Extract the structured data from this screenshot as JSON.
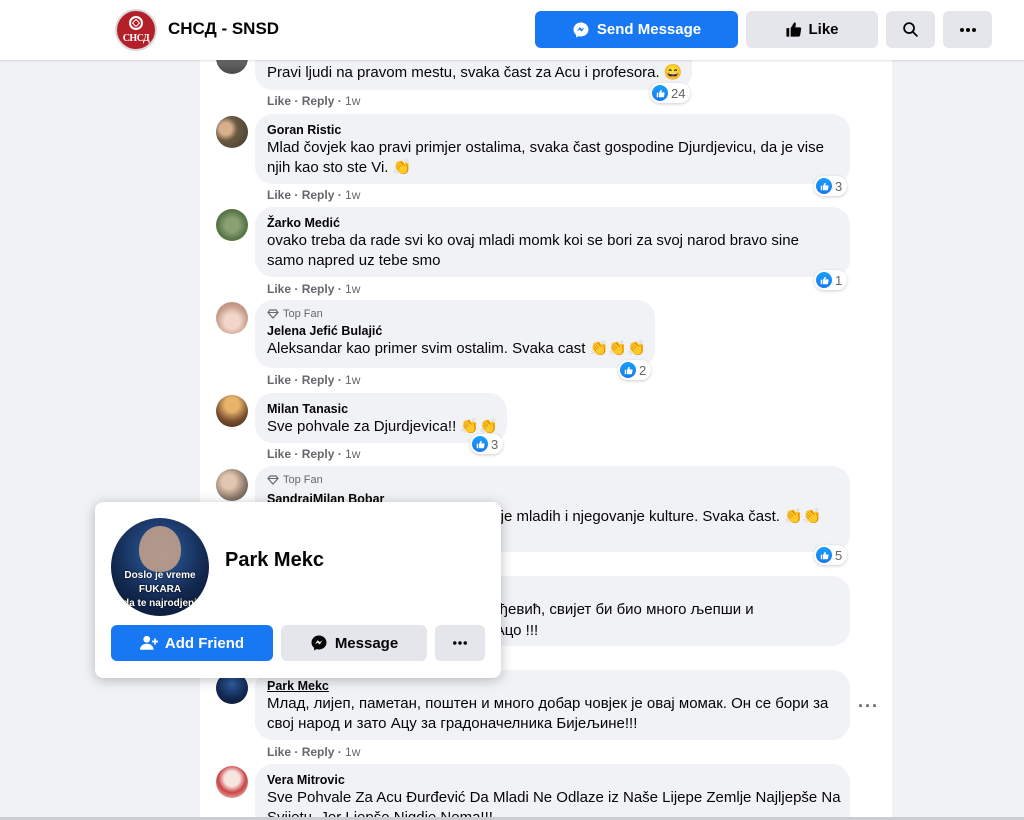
{
  "header": {
    "logo_text": "СНСД",
    "page_name": "СНСД - SNSD",
    "send_message_label": "Send Message",
    "like_label": "Like"
  },
  "comment_actions": {
    "like": "Like",
    "reply": "Reply"
  },
  "comments": [
    {
      "name": "",
      "text": "Pravi ljudi na pravom mestu, svaka čast za Acu i profesora. 😄",
      "time": "1w",
      "reactions": "24"
    },
    {
      "name": "Goran Ristic",
      "text_line1": "Mlad čovjek kao pravi primjer ostalima, svaka čast gospodine Djurdjevicu, da je vise",
      "text_line2": "njih kao sto ste Vi. 👏",
      "time": "1w",
      "reactions": "3"
    },
    {
      "name": "Žarko Medić",
      "text_line1": "ovako treba da rade svi ko ovaj mladi momk koi se bori za svoj narod bravo sine",
      "text_line2": "samo napred uz tebe smo",
      "time": "1w",
      "reactions": "1"
    },
    {
      "badge": "Top Fan",
      "name": "Jelena Jefić Bulajić",
      "text": "Aleksandar kao primer svim ostalim. Svaka cast 👏👏👏",
      "time": "1w",
      "reactions": "2"
    },
    {
      "name": "Milan Tanasic",
      "text": "Sve pohvale za Djurdjevica!! 👏👏",
      "time": "1w",
      "reactions": "3"
    },
    {
      "badge": "Top Fan",
      "name": "SandraiMilan Bobar",
      "text_visible": "анje mladih i njegovanje kulture. Svaka čast. 👏👏",
      "reactions": "5"
    },
    {
      "text_line1_visible": "урђевић, свијет би био много љепши и",
      "text_line2_visible": "к Ацо !!!"
    },
    {
      "name": "Park Mekc",
      "text_line1": "Млад, лијеп, паметан, поштен и много добар човјек је овај момак. Он се бори за",
      "text_line2": "свој народ и зато Ацу за градоначелника Бијељине!!!",
      "time": "1w"
    },
    {
      "name": "Vera Mitrovic",
      "text_line1": "Sve Pohvale Za Acu Đurđević Da Mladi Ne Odlaze iz Naše Lijepe Zemlje Najljepše Na",
      "text_line2": "Svijetu. Jer Ljepše Nigdje Nema!!!"
    }
  ],
  "hover_card": {
    "name": "Park Mekc",
    "avatar_caption_1": "Doslo je vreme",
    "avatar_caption_2": "FUKARA",
    "avatar_caption_3": "da te najrodjeni",
    "add_friend_label": "Add Friend",
    "message_label": "Message"
  },
  "colors": {
    "primary": "#1877f2",
    "bubble": "#f0f2f5",
    "secondary_text": "#65676b",
    "logo_red": "#b3202a"
  },
  "icons": [
    "messenger-icon",
    "thumbs-up-icon",
    "search-icon",
    "more-icon",
    "top-fan-diamond-icon",
    "add-friend-icon"
  ]
}
